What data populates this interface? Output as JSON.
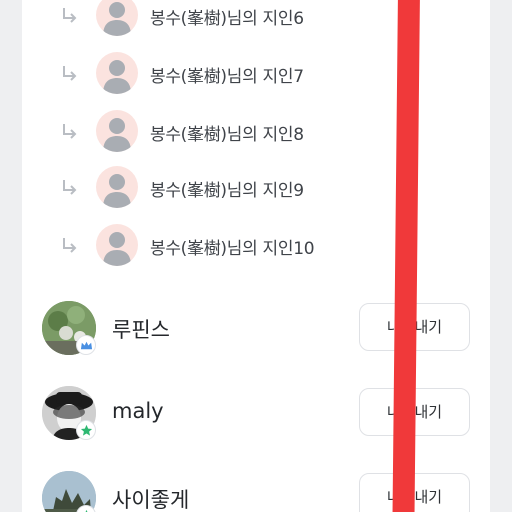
{
  "sub_items": [
    {
      "name": "봉수(峯樹)님의 지인6"
    },
    {
      "name": "봉수(峯樹)님의 지인7"
    },
    {
      "name": "봉수(峯樹)님의 지인8"
    },
    {
      "name": "봉수(峯樹)님의 지인9"
    },
    {
      "name": "봉수(峯樹)님의 지인10"
    }
  ],
  "users": [
    {
      "name": "루핀스",
      "badge": "crown-icon",
      "button": "내보내기"
    },
    {
      "name": "maly",
      "badge": "star-icon",
      "button": "내보내기"
    },
    {
      "name": "사이좋게",
      "badge": "star-icon",
      "button": "내보내기"
    }
  ],
  "colors": {
    "background": "#eeeff1",
    "avatar_placeholder_bg": "#fbe3df",
    "crown_badge": "#4a90e2",
    "star_badge": "#2eb872",
    "overlay_line": "#f0393a"
  }
}
